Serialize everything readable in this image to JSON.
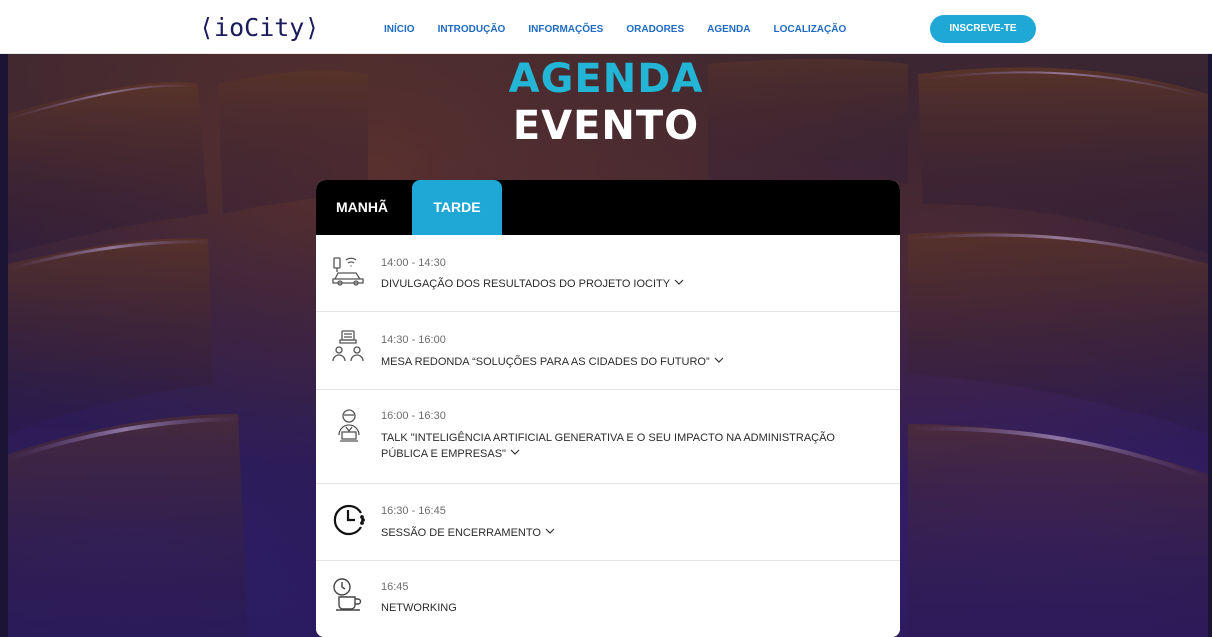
{
  "header": {
    "logo": "⟨ioCity⟩",
    "nav": [
      "INÍCIO",
      "INTRODUÇÃO",
      "INFORMAÇÕES",
      "ORADORES",
      "AGENDA",
      "LOCALIZAÇÃO"
    ],
    "cta": "INSCREVE-TE"
  },
  "heading": {
    "line1": "AGENDA",
    "line2": "EVENTO"
  },
  "tabs": {
    "morning": "MANHÃ",
    "afternoon": "TARDE",
    "active": "afternoon"
  },
  "schedule": [
    {
      "time": "14:00 - 14:30",
      "title": "DIVULGAÇÃO DOS RESULTADOS DO PROJETO IOCITY",
      "icon": "smart-car-icon",
      "expandable": true
    },
    {
      "time": "14:30 - 16:00",
      "title": "MESA REDONDA “SOLUÇÕES PARA AS CIDADES DO FUTURO”",
      "icon": "round-table-icon",
      "expandable": true
    },
    {
      "time": "16:00 - 16:30",
      "title": "TALK \"INTELIGÊNCIA ARTIFICIAL GENERATIVA E O SEU IMPACTO NA ADMINISTRAÇÃO PÚBLICA E EMPRESAS\"",
      "icon": "speaker-icon",
      "expandable": true
    },
    {
      "time": "16:30 - 16:45",
      "title": "SESSÃO DE ENCERRAMENTO",
      "icon": "clock-icon",
      "expandable": true
    },
    {
      "time": "16:45",
      "title": "NETWORKING",
      "icon": "coffee-break-icon",
      "expandable": false
    }
  ],
  "colors": {
    "accent": "#1fa8d6",
    "heading_accent": "#22b5d6",
    "nav": "#1f6bc3",
    "logo": "#1a1a5c"
  }
}
